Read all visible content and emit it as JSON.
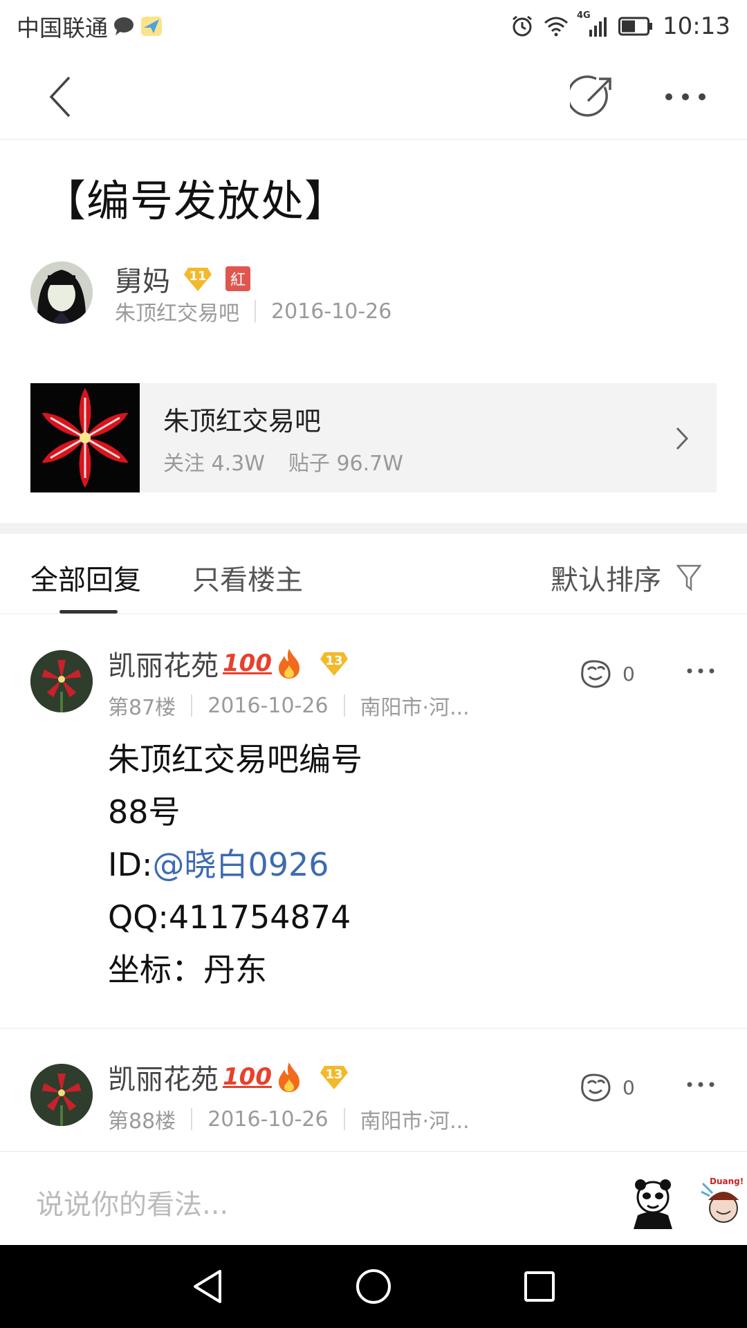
{
  "status_bar": {
    "carrier": "中国联通",
    "network": "4G",
    "time": "10:13",
    "battery_level": 0.55
  },
  "post": {
    "title": "【编号发放处】",
    "author": {
      "name": "舅妈",
      "level": "11",
      "badge": "紅",
      "forum": "朱顶红交易吧",
      "date": "2016-10-26"
    }
  },
  "forum_card": {
    "name": "朱顶红交易吧",
    "followers": "关注 4.3W",
    "posts": "贴子 96.7W"
  },
  "tabs": {
    "all_replies": "全部回复",
    "op_only": "只看楼主",
    "sort": "默认排序"
  },
  "replies": [
    {
      "user": "凯丽花苑",
      "level": "13",
      "floor": "第87楼",
      "date": "2016-10-26",
      "location": "南阳市·河...",
      "likes": "0",
      "lines": {
        "line1": "朱顶红交易吧编号",
        "line2": "88号",
        "line3_prefix": "ID:",
        "line3_mention": "@晓白0926",
        "line4": "QQ:411754874",
        "line5": "坐标：丹东"
      }
    },
    {
      "user": "凯丽花苑",
      "level": "13",
      "floor": "第88楼",
      "date": "2016-10-26",
      "location": "南阳市·河...",
      "likes": "0"
    }
  ],
  "input": {
    "placeholder": "说说你的看法..."
  },
  "colors": {
    "mention": "#3d6bb0",
    "badge_red": "#e0564f",
    "level_gold": "#f3b92a"
  },
  "icons": {
    "back": "chevron-left-icon",
    "share": "share-icon",
    "more": "more-dots-icon",
    "filter": "filter-icon",
    "like": "like-icon",
    "sticker1_text": "Duang!"
  }
}
